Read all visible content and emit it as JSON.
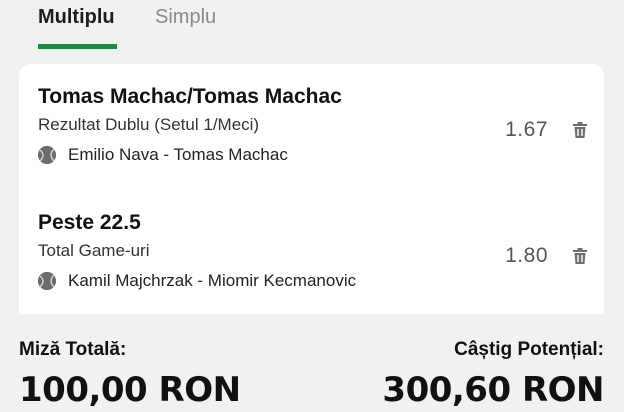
{
  "tabs": [
    {
      "label": "Multiplu",
      "active": true
    },
    {
      "label": "Simplu",
      "active": false
    }
  ],
  "colors": {
    "accent": "#1e8a44",
    "card_bg": "#ffffff",
    "page_bg": "#f1f1f2"
  },
  "selections": [
    {
      "title": "Tomas Machac/Tomas Machac",
      "market": "Rezultat Dublu (Setul 1/Meci)",
      "event": "Emilio Nava - Tomas Machac",
      "odds": "1.67",
      "sport_icon": "tennis-ball-icon",
      "remove_icon": "trash-icon"
    },
    {
      "title": "Peste 22.5",
      "market": "Total Game-uri",
      "event": "Kamil Majchrzak - Miomir Kecmanovic",
      "odds": "1.80",
      "sport_icon": "tennis-ball-icon",
      "remove_icon": "trash-icon"
    }
  ],
  "summary": {
    "stake_label": "Miză Totală:",
    "stake_value": "100,00 RON",
    "win_label": "Câștig Potențial:",
    "win_value": "300,60 RON"
  }
}
